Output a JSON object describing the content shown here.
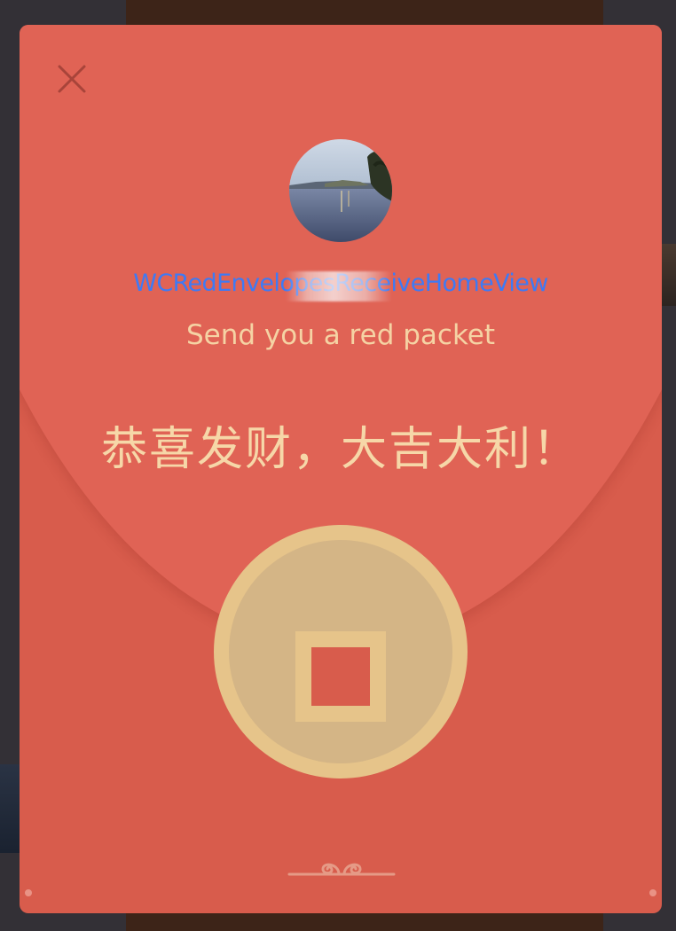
{
  "envelope": {
    "close_icon": "close-icon",
    "avatar_icon": "avatar-lake-photo",
    "sender_name": "WCRedEnvelopesReceiveHomeView",
    "subtitle": "Send you a red packet",
    "greeting": "恭喜发财，大吉大利！",
    "open_button_icon": "coin-icon",
    "ornament_icon": "cloud-scroll-icon"
  },
  "colors": {
    "envelope_red": "#d85c4c",
    "lid_red": "#e06355",
    "gold": "#e6c48a",
    "gold_inner": "#d4b586",
    "text_gold": "#f6d7a8",
    "name_blue": "#3d7af5"
  }
}
